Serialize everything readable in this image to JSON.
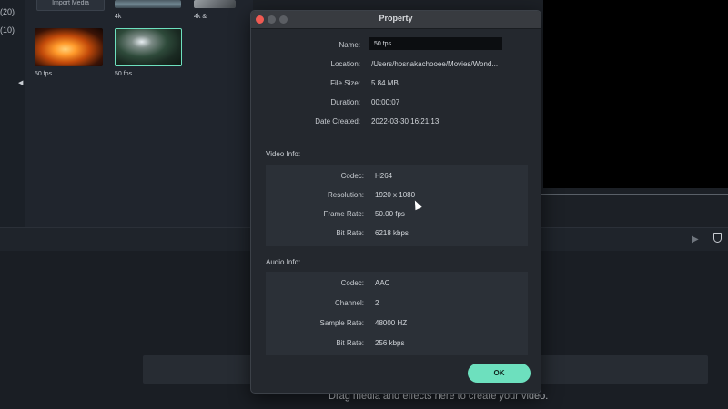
{
  "media_library": {
    "counts": [
      "(20)",
      "(10)"
    ],
    "import_label": "Import Media",
    "items": [
      {
        "caption": "4k"
      },
      {
        "caption": "4k &"
      },
      {
        "caption": "50 fps"
      },
      {
        "caption": "50 fps"
      }
    ]
  },
  "dialog": {
    "title": "Property",
    "general": [
      {
        "label": "Name:",
        "value": "50 fps"
      },
      {
        "label": "Location:",
        "value": "/Users/hosnakachooee/Movies/Wond..."
      },
      {
        "label": "File Size:",
        "value": "5.84 MB"
      },
      {
        "label": "Duration:",
        "value": "00:00:07"
      },
      {
        "label": "Date Created:",
        "value": "2022-03-30 16:21:13"
      }
    ],
    "video_title": "Video Info:",
    "video": [
      {
        "label": "Codec:",
        "value": "H264"
      },
      {
        "label": "Resolution:",
        "value": "1920 x 1080"
      },
      {
        "label": "Frame Rate:",
        "value": "50.00 fps"
      },
      {
        "label": "Bit Rate:",
        "value": "6218 kbps"
      }
    ],
    "audio_title": "Audio Info:",
    "audio": [
      {
        "label": "Codec:",
        "value": "AAC"
      },
      {
        "label": "Channel:",
        "value": "2"
      },
      {
        "label": "Sample Rate:",
        "value": "48000 HZ"
      },
      {
        "label": "Bit Rate:",
        "value": "256 kbps"
      }
    ],
    "ok_label": "OK"
  },
  "timeline": {
    "drop_hint": "Drag media and effects here to create your video."
  },
  "colors": {
    "accent": "#6de0be",
    "close": "#f05a52",
    "dialog_bg": "#24282e"
  },
  "icons": [
    "play-icon",
    "marker-icon",
    "collapse-arrow-icon"
  ]
}
